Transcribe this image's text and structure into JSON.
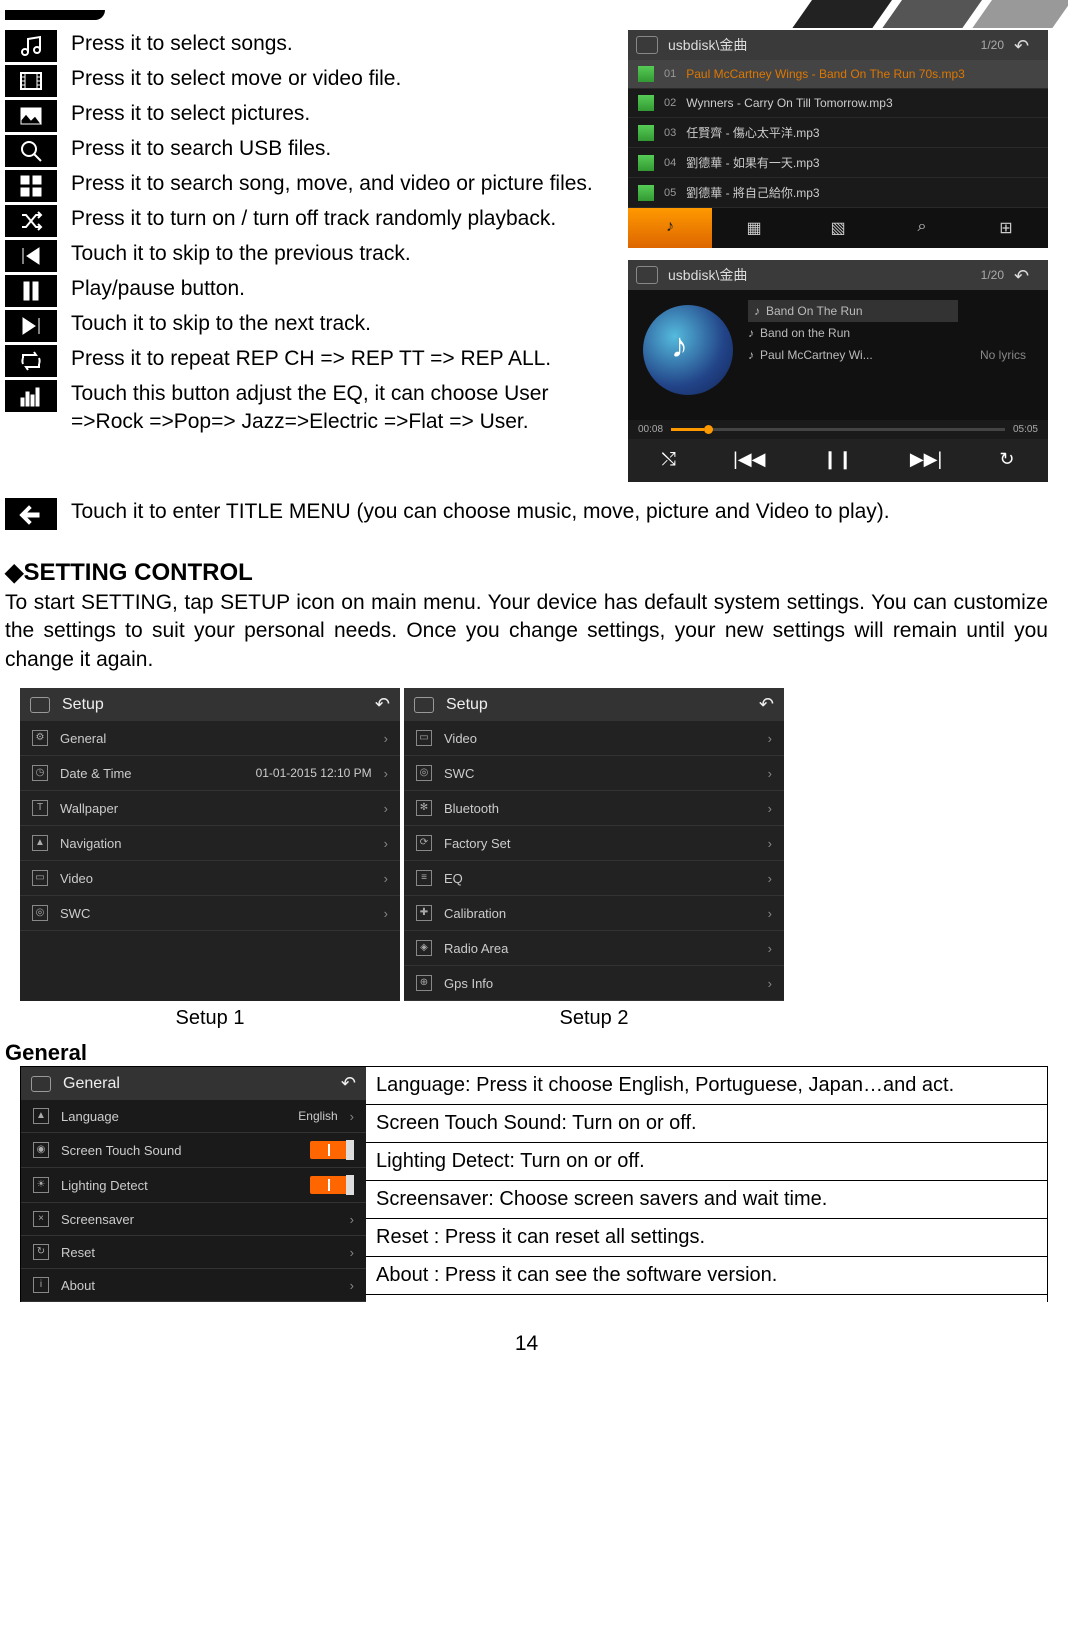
{
  "topbar_decor": true,
  "icon_list": [
    {
      "icon": "music",
      "text": "Press it to select songs."
    },
    {
      "icon": "film",
      "text": "Press it to select move or video file."
    },
    {
      "icon": "picture",
      "text": "Press it to select pictures."
    },
    {
      "icon": "search",
      "text": "Press it to search USB files."
    },
    {
      "icon": "grid",
      "text": "Press it to search song, move, and video or picture files.",
      "wrap": true
    },
    {
      "icon": "shuffle",
      "text": "Press it to turn on / turn off track randomly playback.",
      "wrap": true
    },
    {
      "icon": "prev",
      "text": "Touch it to skip to the previous track."
    },
    {
      "icon": "pause",
      "text": "Play/pause button."
    },
    {
      "icon": "next",
      "text": "Touch it to skip to the next track."
    },
    {
      "icon": "repeat",
      "text": "Press it to repeat REP CH => REP TT => REP ALL.",
      "wrap": true
    },
    {
      "icon": "eq",
      "text": "Touch this button adjust the EQ, it can choose User =>Rock =>Pop=> Jazz=>Electric =>Flat => User.",
      "wrap": true
    },
    {
      "icon": "back",
      "text": "Touch it to enter TITLE MENU (you can choose music, move, picture and Video to play).",
      "full": true
    }
  ],
  "player1": {
    "path": "usbdisk\\金曲",
    "count": "1/20",
    "rows": [
      {
        "num": "01",
        "label": "Paul McCartney  Wings  -  Band On The Run 70s.mp3",
        "sel": true
      },
      {
        "num": "02",
        "label": "Wynners  - Carry On Till Tomorrow.mp3"
      },
      {
        "num": "03",
        "label": "任賢齊 - 傷心太平洋.mp3"
      },
      {
        "num": "04",
        "label": "劉德華 - 如果有一天.mp3"
      },
      {
        "num": "05",
        "label": "劉德華 - 將自己給你.mp3"
      }
    ],
    "tabs": [
      "♪",
      "▦",
      "▧",
      "⌕",
      "⊞"
    ]
  },
  "player2": {
    "path": "usbdisk\\金曲",
    "count": "1/20",
    "tracks": [
      {
        "label": "Band On The Run",
        "sel": true
      },
      {
        "label": "Band on the Run"
      },
      {
        "label": "Paul McCartney  Wi..."
      }
    ],
    "nolyrics": "No lyrics",
    "t0": "00:08",
    "t1": "05:05",
    "controls": [
      "⤭",
      "|◀◀",
      "❙❙",
      "▶▶|",
      "↻"
    ]
  },
  "setting": {
    "heading": "◆SETTING CONTROL",
    "desc": "To start SETTING, tap SETUP icon on main menu. Your device has default system settings. You can customize the settings to suit your personal needs. Once you change settings, your new settings will remain until you change it again.",
    "setup1": {
      "title": "Setup",
      "caption": "Setup 1",
      "items": [
        {
          "icon": "⚙",
          "label": "General"
        },
        {
          "icon": "◷",
          "label": "Date & Time",
          "val": "01-01-2015  12:10 PM"
        },
        {
          "icon": "T",
          "label": "Wallpaper"
        },
        {
          "icon": "▲",
          "label": "Navigation"
        },
        {
          "icon": "▭",
          "label": "Video"
        },
        {
          "icon": "◎",
          "label": "SWC"
        }
      ]
    },
    "setup2": {
      "title": "Setup",
      "caption": "Setup 2",
      "items": [
        {
          "icon": "▭",
          "label": "Video",
          "top": true
        },
        {
          "icon": "◎",
          "label": "SWC"
        },
        {
          "icon": "✻",
          "label": "Bluetooth"
        },
        {
          "icon": "⟳",
          "label": "Factory Set"
        },
        {
          "icon": "≡",
          "label": "EQ"
        },
        {
          "icon": "✚",
          "label": "Calibration"
        },
        {
          "icon": "◈",
          "label": "Radio Area"
        },
        {
          "icon": "⊕",
          "label": "Gps Info"
        }
      ]
    }
  },
  "general": {
    "heading": "General",
    "panel": {
      "title": "General",
      "items": [
        {
          "icon": "▲",
          "label": "Language",
          "val": "English",
          "chev": true
        },
        {
          "icon": "◉",
          "label": "Screen Touch Sound",
          "toggle": true
        },
        {
          "icon": "☀",
          "label": "Lighting Detect",
          "toggle": true
        },
        {
          "icon": "×",
          "label": "Screensaver",
          "chev": true
        },
        {
          "icon": "↻",
          "label": "Reset"
        },
        {
          "icon": "i",
          "label": "About",
          "chev": true
        }
      ]
    },
    "desc": [
      "Language: Press it choose English, Portuguese, Japan…and act.",
      "Screen Touch Sound: Turn on or off.",
      "Lighting Detect: Turn on or off.",
      "Screensaver: Choose screen savers and wait time.",
      "Reset : Press it can reset all settings.",
      "About : Press it can see the software version."
    ]
  },
  "page_num": "14"
}
